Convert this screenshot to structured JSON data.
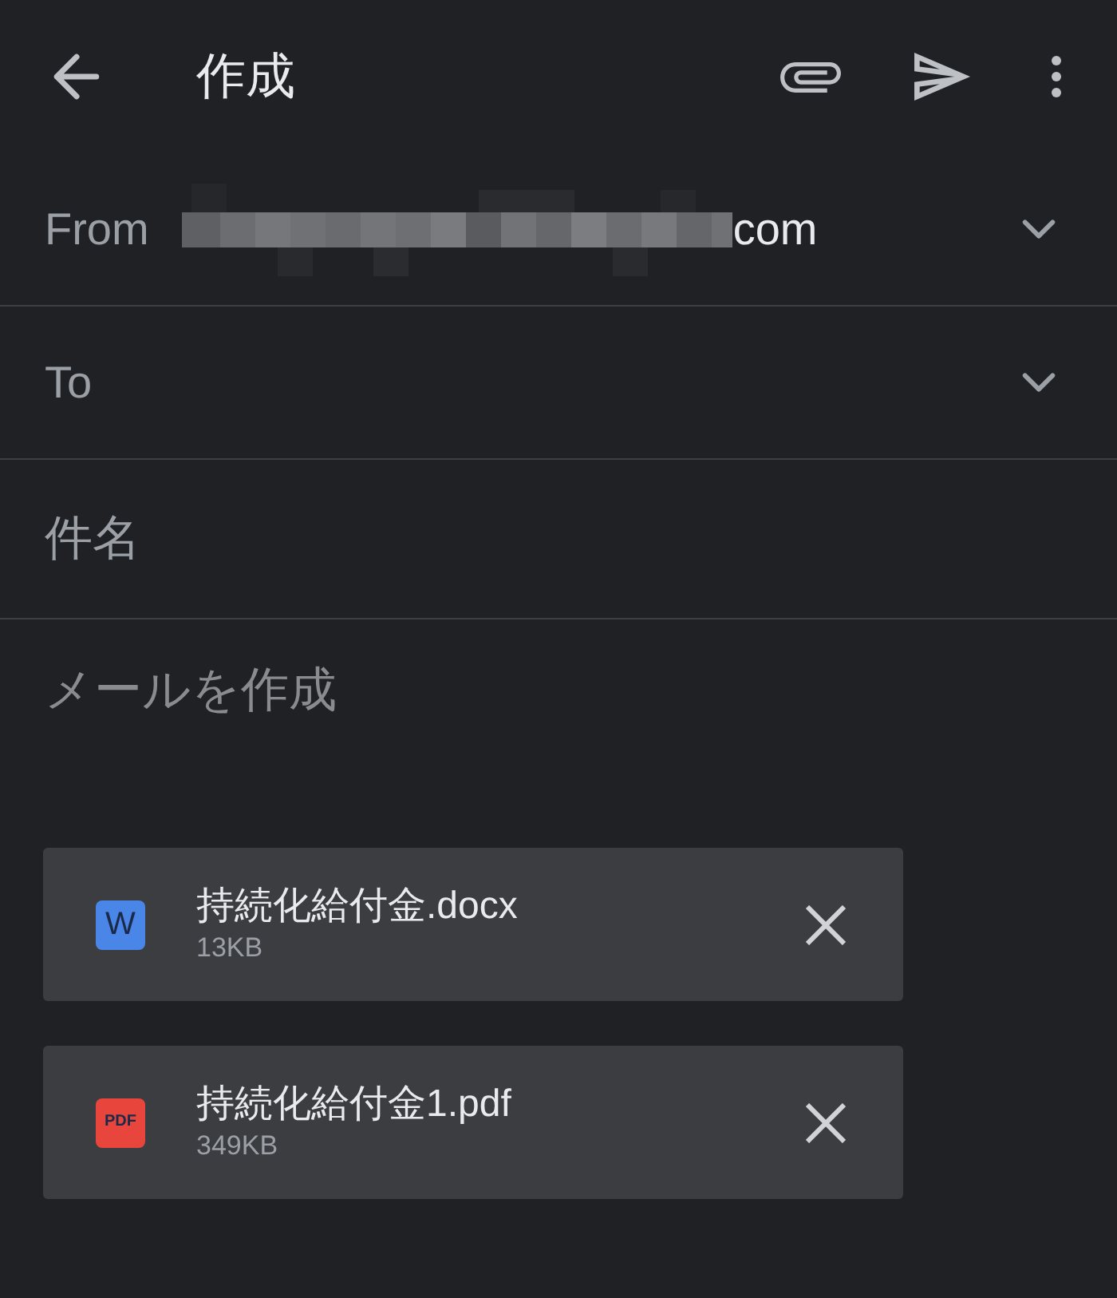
{
  "app_bar": {
    "title": "作成"
  },
  "from": {
    "label": "From",
    "redacted": true,
    "value": "com"
  },
  "to": {
    "label": "To"
  },
  "subject": {
    "placeholder": "件名"
  },
  "body": {
    "placeholder": "メールを作成"
  },
  "attachments": [
    {
      "badge": "W",
      "color": "#4a86e8",
      "name": "持続化給付金.docx",
      "size": "13KB"
    },
    {
      "badge": "PDF",
      "color": "#e8453c",
      "name": "持続化給付金1.pdf",
      "size": "349KB"
    }
  ]
}
